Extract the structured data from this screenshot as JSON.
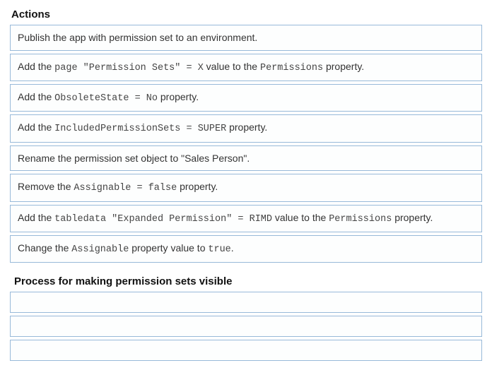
{
  "sections": {
    "actions": {
      "title": "Actions",
      "items": [
        {
          "segments": [
            {
              "t": "text",
              "v": "Publish the app with permission set to an environment."
            }
          ]
        },
        {
          "segments": [
            {
              "t": "text",
              "v": "Add the "
            },
            {
              "t": "code",
              "v": "page \"Permission Sets\" = X"
            },
            {
              "t": "text",
              "v": " value to the "
            },
            {
              "t": "code",
              "v": "Permissions"
            },
            {
              "t": "text",
              "v": " property."
            }
          ]
        },
        {
          "segments": [
            {
              "t": "text",
              "v": "Add the "
            },
            {
              "t": "code",
              "v": "ObsoleteState = No"
            },
            {
              "t": "text",
              "v": " property."
            }
          ]
        },
        {
          "segments": [
            {
              "t": "text",
              "v": "Add the "
            },
            {
              "t": "code",
              "v": "IncludedPermissionSets = SUPER"
            },
            {
              "t": "text",
              "v": " property."
            }
          ]
        },
        {
          "segments": [
            {
              "t": "text",
              "v": "Rename the permission set object to \"Sales Person\"."
            }
          ]
        },
        {
          "segments": [
            {
              "t": "text",
              "v": "Remove the "
            },
            {
              "t": "code",
              "v": "Assignable = false"
            },
            {
              "t": "text",
              "v": " property."
            }
          ]
        },
        {
          "segments": [
            {
              "t": "text",
              "v": "Add the "
            },
            {
              "t": "code",
              "v": "tabledata \"Expanded Permission\" = RIMD"
            },
            {
              "t": "text",
              "v": " value to the "
            },
            {
              "t": "code",
              "v": "Permissions"
            },
            {
              "t": "text",
              "v": " property."
            }
          ]
        },
        {
          "segments": [
            {
              "t": "text",
              "v": "Change the "
            },
            {
              "t": "code",
              "v": "Assignable"
            },
            {
              "t": "text",
              "v": " property value to "
            },
            {
              "t": "code",
              "v": "true"
            },
            {
              "t": "text",
              "v": ". "
            }
          ]
        }
      ]
    },
    "process": {
      "title": "Process for making permission sets visible",
      "slots": 3
    }
  }
}
